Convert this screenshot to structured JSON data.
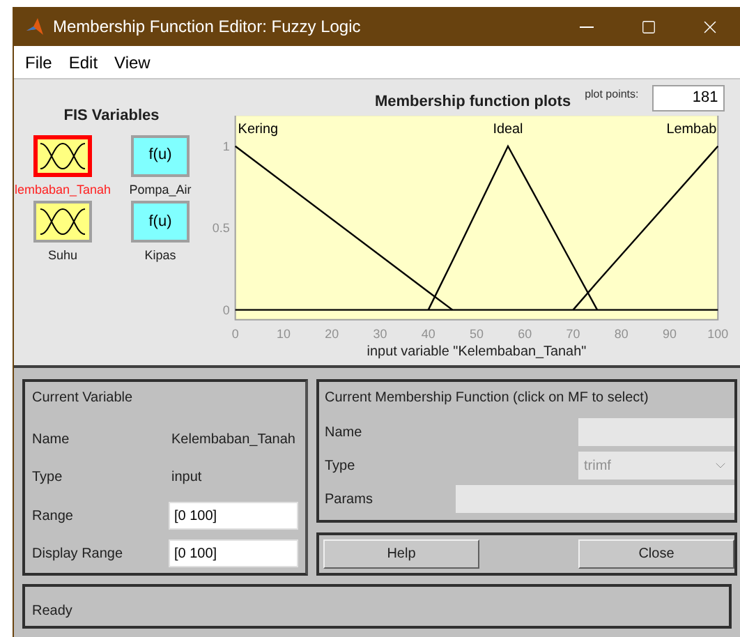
{
  "window": {
    "title": "Membership Function Editor: Fuzzy Logic"
  },
  "menu": [
    {
      "label": "File"
    },
    {
      "label": "Edit"
    },
    {
      "label": "View"
    }
  ],
  "fis_variables": {
    "title": "FIS Variables",
    "items": [
      {
        "name": "lembaban_Tanah",
        "kind": "input",
        "selected": true
      },
      {
        "name": "Pompa_Air",
        "kind": "output",
        "symbol": "f(u)",
        "selected": false
      },
      {
        "name": "Suhu",
        "kind": "input",
        "selected": false
      },
      {
        "name": "Kipas",
        "kind": "output",
        "symbol": "f(u)",
        "selected": false
      }
    ]
  },
  "plot": {
    "plot_points_label": "plot points:",
    "plot_points": "181",
    "chart_data": {
      "type": "line",
      "title": "Membership function plots",
      "xlabel": "input variable \"Kelembaban_Tanah\"",
      "x": [
        0,
        40,
        45,
        56.5,
        70,
        75,
        100
      ],
      "series": [
        {
          "name": "Kering",
          "color": "#000000",
          "values": [
            1,
            0.11,
            0,
            null,
            null,
            null,
            null
          ]
        },
        {
          "name": "Ideal",
          "color": "#000000",
          "values": [
            null,
            0,
            0.3,
            1,
            0.27,
            0,
            null
          ]
        },
        {
          "name": "Lembab",
          "color": "#000000",
          "values": [
            null,
            null,
            null,
            null,
            0,
            0.17,
            1
          ]
        }
      ],
      "xlim": [
        0,
        100
      ],
      "ylim": [
        -0.06,
        1.19
      ],
      "xticks": [
        0,
        10,
        20,
        30,
        40,
        50,
        60,
        70,
        80,
        90,
        100
      ],
      "yticks": [
        0,
        0.5,
        1
      ]
    }
  },
  "current_variable": {
    "title": "Current Variable",
    "rows": [
      {
        "label": "Name",
        "value": "Kelembaban_Tanah",
        "kind": "text"
      },
      {
        "label": "Type",
        "value": "input",
        "kind": "text"
      },
      {
        "label": "Range",
        "value": "[0 100]",
        "kind": "field"
      },
      {
        "label": "Display Range",
        "value": "[0 100]",
        "kind": "field"
      }
    ]
  },
  "current_mf": {
    "title": "Current Membership Function (click on MF to select)",
    "fields": [
      {
        "label": "Name",
        "kind": "text",
        "disabled": true
      },
      {
        "label": "Type",
        "kind": "select",
        "value": "trimf",
        "disabled": true
      },
      {
        "label": "Params",
        "kind": "wide",
        "disabled": true
      }
    ]
  },
  "buttons": [
    {
      "label": "Help"
    },
    {
      "label": "Close"
    }
  ],
  "status": "Ready"
}
